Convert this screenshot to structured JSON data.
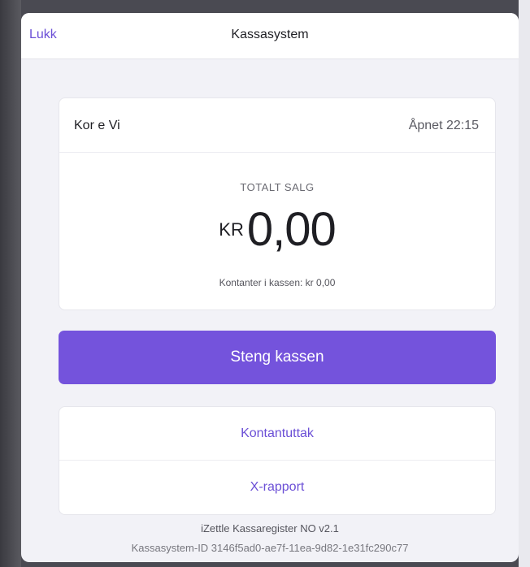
{
  "header": {
    "close_label": "Lukk",
    "title": "Kassasystem"
  },
  "register": {
    "name": "Kor e Vi",
    "opened": "Åpnet 22:15",
    "total_label": "TOTALT SALG",
    "currency": "KR",
    "total_amount": "0,00",
    "cash_in_drawer": "Kontanter i kassen: kr 0,00"
  },
  "actions": {
    "close_register": "Steng kassen",
    "cash_withdrawal": "Kontantuttak",
    "x_report": "X-rapport"
  },
  "footer": {
    "version": "iZettle Kassaregister NO v2.1",
    "system_id": "Kassasystem-ID 3146f5ad0-ae7f-11ea-9d82-1e31fc290c77"
  },
  "colors": {
    "accent": "#7453dc",
    "link": "#6b4fd6",
    "background": "#f2f2f7"
  }
}
